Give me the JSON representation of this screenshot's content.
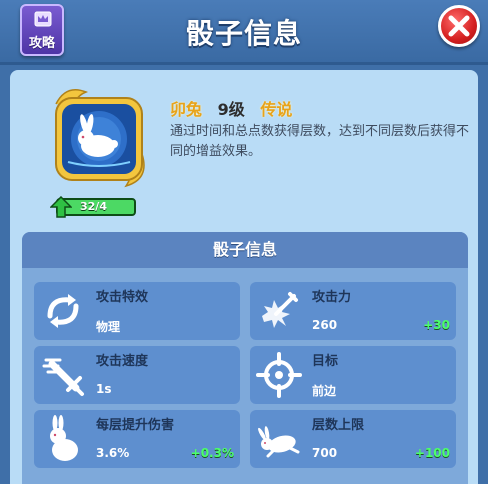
{
  "header": {
    "title": "骰子信息",
    "guide_label": "攻略",
    "guide_icon": "crown-book-icon",
    "close_icon": "close-x-icon"
  },
  "hero": {
    "name": "卯兔",
    "level": "9级",
    "rarity": "传说",
    "description": "通过时间和总点数获得层数，达到不同层数后获得不同的增益效果。",
    "progress_text": "32/4",
    "progress_fraction": 1.0,
    "portrait_icon": "white-rabbit-icon"
  },
  "info": {
    "heading": "骰子信息",
    "stats": [
      {
        "label": "攻击特效",
        "value": "物理",
        "bonus": "",
        "icon": "swirl-arrows-icon"
      },
      {
        "label": "攻击力",
        "value": "260",
        "bonus": "+30",
        "icon": "sword-burst-icon"
      },
      {
        "label": "攻击速度",
        "value": "1s",
        "bonus": "",
        "icon": "sword-speed-icon"
      },
      {
        "label": "目标",
        "value": "前边",
        "bonus": "",
        "icon": "crosshair-icon"
      },
      {
        "label": "每层提升伤害",
        "value": "3.6%",
        "bonus": "+0.3%",
        "icon": "sitting-rabbit-icon"
      },
      {
        "label": "层数上限",
        "value": "700",
        "bonus": "+100",
        "icon": "jumping-rabbit-icon"
      }
    ]
  },
  "colors": {
    "header": "#3f6fa8",
    "panel": "#b9dcf6",
    "card": "#5e8fcf",
    "gold_text": "#e8a31a",
    "bonus_green": "#4cff6a",
    "close_red": "#d42020"
  }
}
